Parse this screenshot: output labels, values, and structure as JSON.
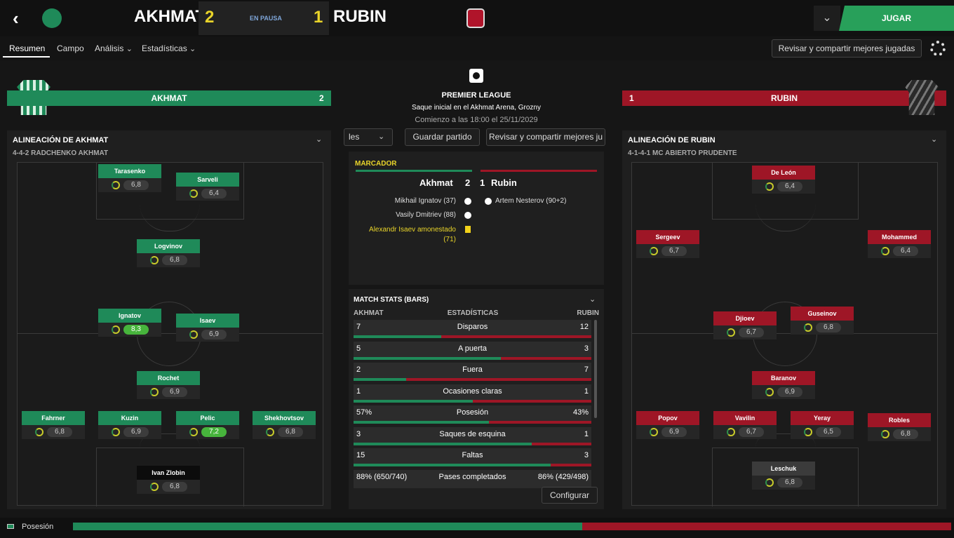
{
  "header": {
    "home_team": "AKHMAT",
    "home_score": "2",
    "status": "EN PAUSA",
    "away_score": "1",
    "away_team": "RUBIN",
    "play_label": "JUGAR",
    "dropdown_icon": "chevron-down-icon"
  },
  "tabs": [
    {
      "label": "Resumen"
    },
    {
      "label": "Campo"
    },
    {
      "label": "Análisis"
    },
    {
      "label": "Estadísticas"
    }
  ],
  "review_label": "Revisar y compartir mejores jugadas",
  "home_panel": {
    "name": "AKHMAT",
    "score": "2",
    "lineup_title": "ALINEACIÓN DE AKHMAT",
    "formation": "4-4-2 RADCHENKO AKHMAT",
    "players": [
      {
        "name": "Tarasenko",
        "rating": "6,8"
      },
      {
        "name": "Sarveli",
        "rating": "6,4"
      },
      {
        "name": "Logvinov",
        "rating": "6,8"
      },
      {
        "name": "Ignatov",
        "rating": "8,3"
      },
      {
        "name": "Isaev",
        "rating": "6,9"
      },
      {
        "name": "Rochet",
        "rating": "6,9"
      },
      {
        "name": "Fahrner",
        "rating": "6,8"
      },
      {
        "name": "Kuzin",
        "rating": "6,9"
      },
      {
        "name": "Pelic",
        "rating": "7,2"
      },
      {
        "name": "Shekhovtsov",
        "rating": "6,8"
      },
      {
        "name": "Ivan Zlobin",
        "rating": "6,8"
      }
    ]
  },
  "away_panel": {
    "name": "RUBIN",
    "score": "1",
    "lineup_title": "ALINEACIÓN DE RUBIN",
    "formation": "4-1-4-1 MC ABIERTO PRUDENTE",
    "players": [
      {
        "name": "De León",
        "rating": "6,4"
      },
      {
        "name": "Sergeev",
        "rating": "6,7"
      },
      {
        "name": "Mohammed",
        "rating": "6,4"
      },
      {
        "name": "Djioev",
        "rating": "6,7"
      },
      {
        "name": "Guseinov",
        "rating": "6,8"
      },
      {
        "name": "Baranov",
        "rating": "6,9"
      },
      {
        "name": "Popov",
        "rating": "6,9"
      },
      {
        "name": "Vavilin",
        "rating": "6,7"
      },
      {
        "name": "Yeray",
        "rating": "6,5"
      },
      {
        "name": "Robles",
        "rating": "6,8"
      },
      {
        "name": "Leschuk",
        "rating": "6,8"
      }
    ]
  },
  "match_info": {
    "league": "PREMIER LEAGUE",
    "kickoff": "Saque inicial en el Akhmat Arena, Grozny",
    "start": "Comienzo a las 18:00 el 25/11/2029"
  },
  "center_buttons": {
    "left_partial": "les",
    "save": "Guardar partido",
    "review": "Revisar y compartir mejores ju"
  },
  "scoreboard": {
    "title": "MARCADOR",
    "home": "Akhmat",
    "home_score": "2",
    "away_score": "1",
    "away": "Rubin",
    "events_home": [
      "Mikhail Ignatov (37)",
      "Vasily Dmitriev (88)"
    ],
    "card_home": "Alexandr Isaev amonestado",
    "card_home_min": "(71)",
    "events_away": [
      "Artem Nesterov (90+2)"
    ]
  },
  "stats": {
    "title": "MATCH STATS (BARS)",
    "col_home": "AKHMAT",
    "col_mid": "ESTADÍSTICAS",
    "col_away": "RUBIN",
    "configure": "Configurar",
    "rows": [
      {
        "label": "Disparos",
        "home": "7",
        "away": "12",
        "home_share": 0.37
      },
      {
        "label": "A puerta",
        "home": "5",
        "away": "3",
        "home_share": 0.62
      },
      {
        "label": "Fuera",
        "home": "2",
        "away": "7",
        "home_share": 0.22
      },
      {
        "label": "Ocasiones claras",
        "home": "1",
        "away": "1",
        "home_share": 0.5
      },
      {
        "label": "Posesión",
        "home": "57%",
        "away": "43%",
        "home_share": 0.57
      },
      {
        "label": "Saques de esquina",
        "home": "3",
        "away": "1",
        "home_share": 0.75
      },
      {
        "label": "Faltas",
        "home": "15",
        "away": "3",
        "home_share": 0.83
      },
      {
        "label": "Pases completados",
        "home": "88% (650/740)",
        "away": "86% (429/498)",
        "home_share": null
      }
    ]
  },
  "footer": {
    "label": "Posesión",
    "home_possession": 0.58
  },
  "colors": {
    "home": "#1f8a59",
    "away": "#9e1626",
    "accent": "#e9d42a"
  }
}
